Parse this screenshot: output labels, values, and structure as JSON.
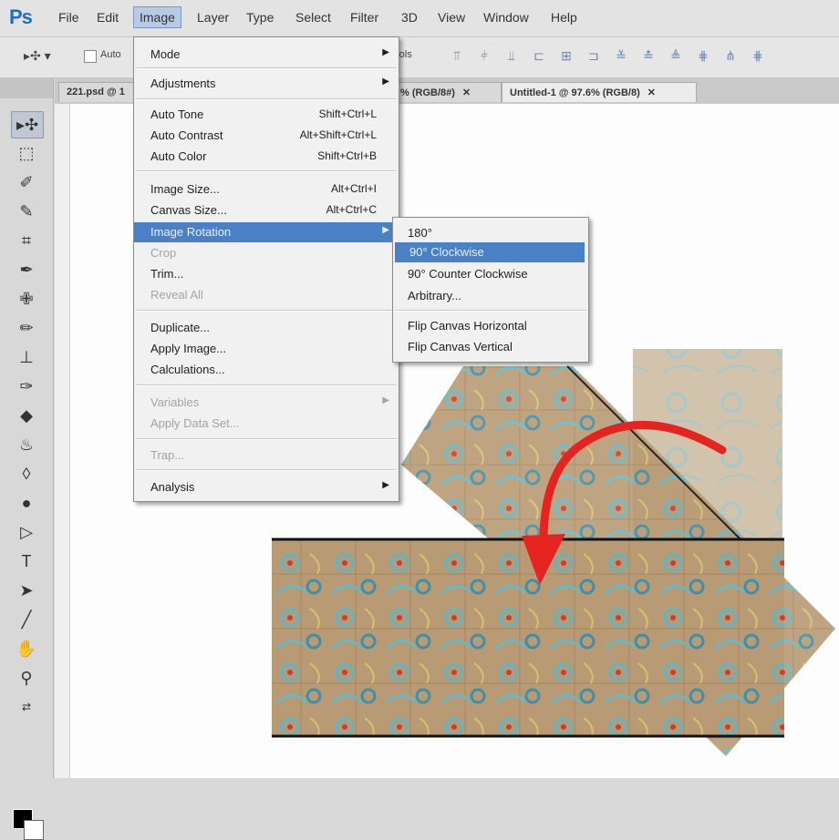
{
  "menubar": {
    "logo": "Ps",
    "items": [
      "File",
      "Edit",
      "Image",
      "Layer",
      "Type",
      "Select",
      "Filter",
      "3D",
      "View",
      "Window",
      "Help"
    ],
    "active": "Image"
  },
  "options": {
    "auto_label": "Auto",
    "controls_label": "rols"
  },
  "tabs": [
    {
      "label": "221.psd @ 1"
    },
    {
      "label": "% (RGB/8#)"
    },
    {
      "label": "Untitled-1 @ 97.6% (RGB/8)"
    }
  ],
  "image_menu": {
    "items": [
      {
        "label": "Mode",
        "shortcut": "",
        "submenu": true,
        "disabled": false
      },
      {
        "label": "Adjustments",
        "shortcut": "",
        "submenu": true,
        "disabled": false
      },
      {
        "label": "Auto Tone",
        "shortcut": "Shift+Ctrl+L",
        "submenu": false,
        "disabled": false
      },
      {
        "label": "Auto Contrast",
        "shortcut": "Alt+Shift+Ctrl+L",
        "submenu": false,
        "disabled": false
      },
      {
        "label": "Auto Color",
        "shortcut": "Shift+Ctrl+B",
        "submenu": false,
        "disabled": false
      },
      {
        "label": "Image Size...",
        "shortcut": "Alt+Ctrl+I",
        "submenu": false,
        "disabled": false
      },
      {
        "label": "Canvas Size...",
        "shortcut": "Alt+Ctrl+C",
        "submenu": false,
        "disabled": false
      },
      {
        "label": "Image Rotation",
        "shortcut": "",
        "submenu": true,
        "disabled": false,
        "highlighted": true
      },
      {
        "label": "Crop",
        "shortcut": "",
        "submenu": false,
        "disabled": true
      },
      {
        "label": "Trim...",
        "shortcut": "",
        "submenu": false,
        "disabled": false
      },
      {
        "label": "Reveal All",
        "shortcut": "",
        "submenu": false,
        "disabled": true
      },
      {
        "label": "Duplicate...",
        "shortcut": "",
        "submenu": false,
        "disabled": false
      },
      {
        "label": "Apply Image...",
        "shortcut": "",
        "submenu": false,
        "disabled": false
      },
      {
        "label": "Calculations...",
        "shortcut": "",
        "submenu": false,
        "disabled": false
      },
      {
        "label": "Variables",
        "shortcut": "",
        "submenu": true,
        "disabled": true
      },
      {
        "label": "Apply Data Set...",
        "shortcut": "",
        "submenu": false,
        "disabled": true
      },
      {
        "label": "Trap...",
        "shortcut": "",
        "submenu": false,
        "disabled": true
      },
      {
        "label": "Analysis",
        "shortcut": "",
        "submenu": true,
        "disabled": false
      }
    ]
  },
  "rotation_submenu": {
    "items": [
      {
        "label": "180°"
      },
      {
        "label": "90° Clockwise",
        "highlighted": true
      },
      {
        "label": "90° Counter Clockwise"
      },
      {
        "label": "Arbitrary..."
      },
      {
        "label": "Flip Canvas Horizontal"
      },
      {
        "label": "Flip Canvas Vertical"
      }
    ]
  },
  "colors": {
    "highlight": "#4a80c6",
    "arrow": "#e52420",
    "fabric": "#b89a74"
  }
}
